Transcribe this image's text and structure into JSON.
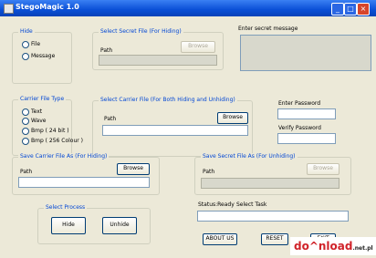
{
  "window": {
    "title": "StegoMagic 1.0"
  },
  "hide": {
    "label": "Hide",
    "options": [
      "File",
      "Message"
    ]
  },
  "secret_file": {
    "label": "Select Secret File (For Hiding)",
    "path_label": "Path",
    "browse": "Browse"
  },
  "secret_message": {
    "label": "Enter secret message"
  },
  "carrier_type": {
    "label": "Carrier File Type",
    "options": [
      "Text",
      "Wave",
      "Bmp ( 24 bit )",
      "Bmp ( 256 Colour )"
    ]
  },
  "carrier_file": {
    "label": "Select Carrier File (For Both Hiding and Unhiding)",
    "path_label": "Path",
    "browse": "Browse"
  },
  "password": {
    "enter_label": "Enter Password",
    "verify_label": "Verify Password"
  },
  "save_carrier": {
    "label": "Save Carrier File As (For Hiding)",
    "path_label": "Path",
    "browse": "Browse"
  },
  "save_secret": {
    "label": "Save Secret File As (For Unhiding)",
    "path_label": "Path",
    "browse": "Browse"
  },
  "process": {
    "label": "Select Process",
    "hide": "Hide",
    "unhide": "Unhide"
  },
  "status": {
    "status_text": "Status:Ready",
    "task_text": "Select Task"
  },
  "footer": {
    "about": "ABOUT US",
    "reset": "RESET",
    "exit": "EXIT"
  },
  "watermark": {
    "text": "do^nload",
    "suffix": ".net.pl"
  }
}
